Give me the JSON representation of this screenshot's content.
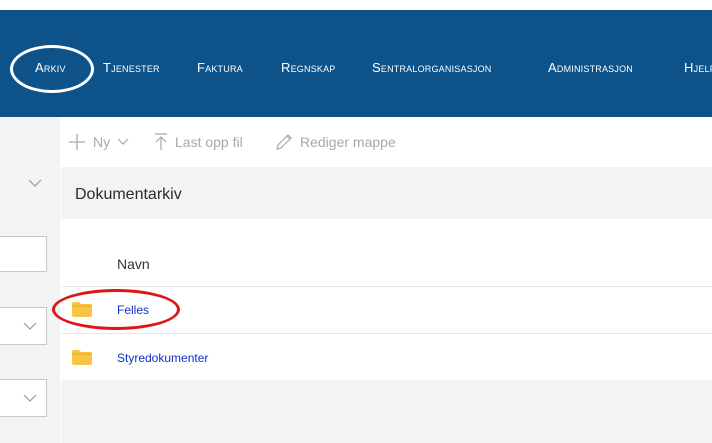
{
  "nav": {
    "items": [
      {
        "label": "Arkiv"
      },
      {
        "label": "Tjenester"
      },
      {
        "label": "Faktura"
      },
      {
        "label": "Regnskap"
      },
      {
        "label": "Sentralorganisasjon"
      },
      {
        "label": "Administrasjon"
      },
      {
        "label": "Hjelp"
      }
    ]
  },
  "toolbar": {
    "new_label": "Ny",
    "upload_label": "Last opp fil",
    "edit_label": "Rediger mappe"
  },
  "main": {
    "title": "Dokumentarkiv",
    "column_header": "Navn",
    "rows": [
      {
        "name": "Felles",
        "icon": "folder-icon"
      },
      {
        "name": "Styredokumenter",
        "icon": "folder-icon"
      }
    ]
  },
  "colors": {
    "nav_bg": "#0d5289",
    "link": "#0d30c9",
    "folder": "#f7c443",
    "highlight_ring": "#e01616"
  }
}
